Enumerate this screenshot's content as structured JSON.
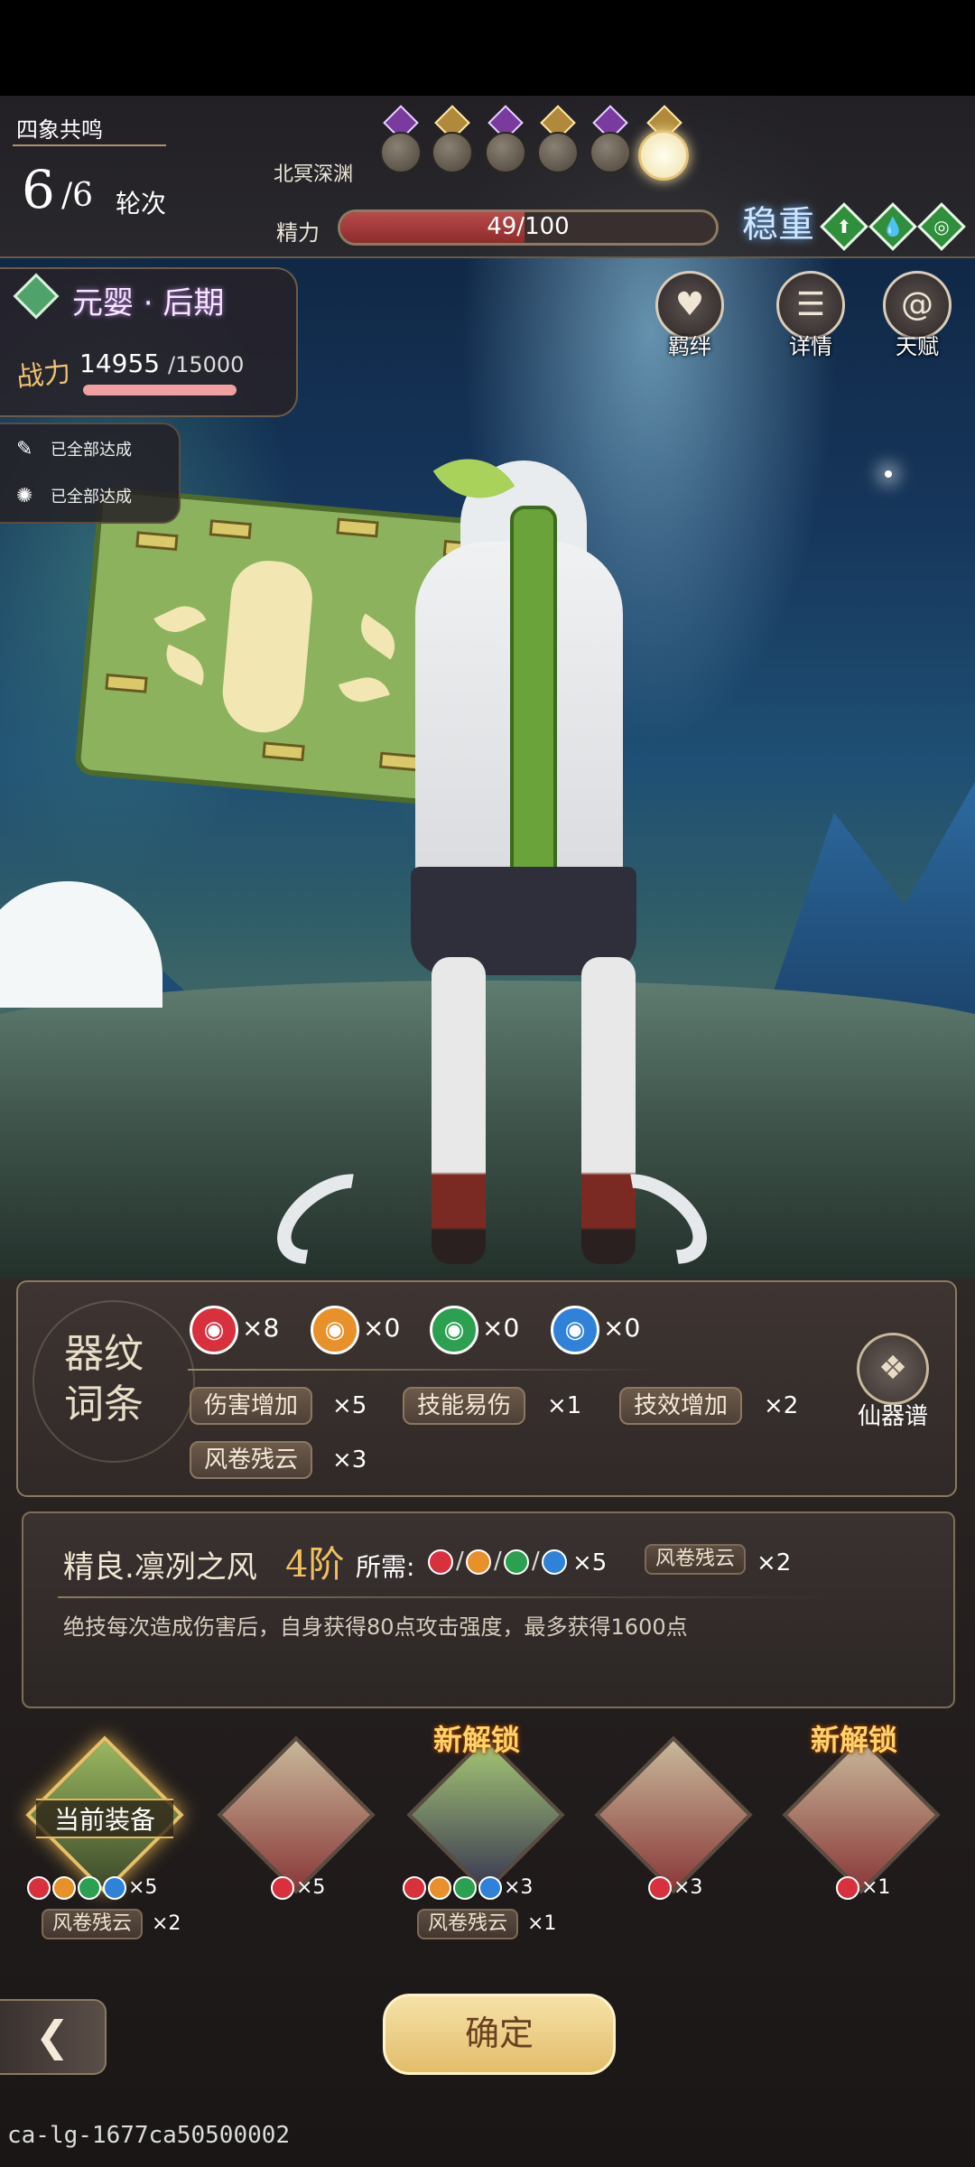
{
  "hud": {
    "resonance_title": "四象共鸣",
    "round_current": "6",
    "round_total": "/6",
    "round_label": "轮次",
    "stage_name": "北冥深渊",
    "energy_label": "精力",
    "energy_text": "49/100",
    "energy_fraction": 0.49,
    "stance": "稳重",
    "stat_gems": [
      "⬆",
      "💧",
      "◎"
    ]
  },
  "side_buttons": [
    {
      "label": "羁绊",
      "icon": "heart-icon"
    },
    {
      "label": "详情",
      "icon": "person-icon"
    },
    {
      "label": "天赋",
      "icon": "swirl-icon"
    }
  ],
  "realm": {
    "name": "元婴 · 后期",
    "power_label": "战力",
    "power_value": "14955",
    "power_max": "/15000"
  },
  "goals": [
    {
      "text": "已全部达成",
      "icon": "scroll-icon"
    },
    {
      "text": "已全部达成",
      "icon": "burst-icon"
    }
  ],
  "inscription": {
    "title": "器纹词条",
    "elements": [
      {
        "count": "×8",
        "color": "#d8303c"
      },
      {
        "count": "×0",
        "color": "#e8902a"
      },
      {
        "count": "×0",
        "color": "#2aa050"
      },
      {
        "count": "×0",
        "color": "#2f82d8"
      }
    ],
    "traits": [
      {
        "label": "伤害增加",
        "count": "×5"
      },
      {
        "label": "技能易伤",
        "count": "×1"
      },
      {
        "label": "技效增加",
        "count": "×2"
      },
      {
        "label": "风卷残云",
        "count": "×3"
      }
    ],
    "artifact_label": "仙器谱"
  },
  "detail": {
    "name": "精良.凛冽之风",
    "tier": "4阶",
    "need_label": "所需:",
    "need_count": "×5",
    "chip_label": "风卷残云",
    "chip_count": "×2",
    "description": "绝技每次造成伤害后，自身获得80点攻击强度，最多获得1600点"
  },
  "slots": [
    {
      "current_label": "当前装备",
      "req_count": "×5",
      "chip": "风卷残云",
      "chip_count": "×2",
      "new": ""
    },
    {
      "current_label": "",
      "req_count": "×5",
      "chip": "",
      "chip_count": "",
      "new": ""
    },
    {
      "current_label": "",
      "req_count": "×3",
      "chip": "风卷残云",
      "chip_count": "×1",
      "new": "新解锁"
    },
    {
      "current_label": "",
      "req_count": "×3",
      "chip": "",
      "chip_count": "",
      "new": ""
    },
    {
      "current_label": "",
      "req_count": "×1",
      "chip": "",
      "chip_count": "",
      "new": "新解锁"
    }
  ],
  "confirm_label": "确定",
  "back_icon": "back-arrow-icon",
  "footer_id": "ca-lg-1677ca50500002"
}
